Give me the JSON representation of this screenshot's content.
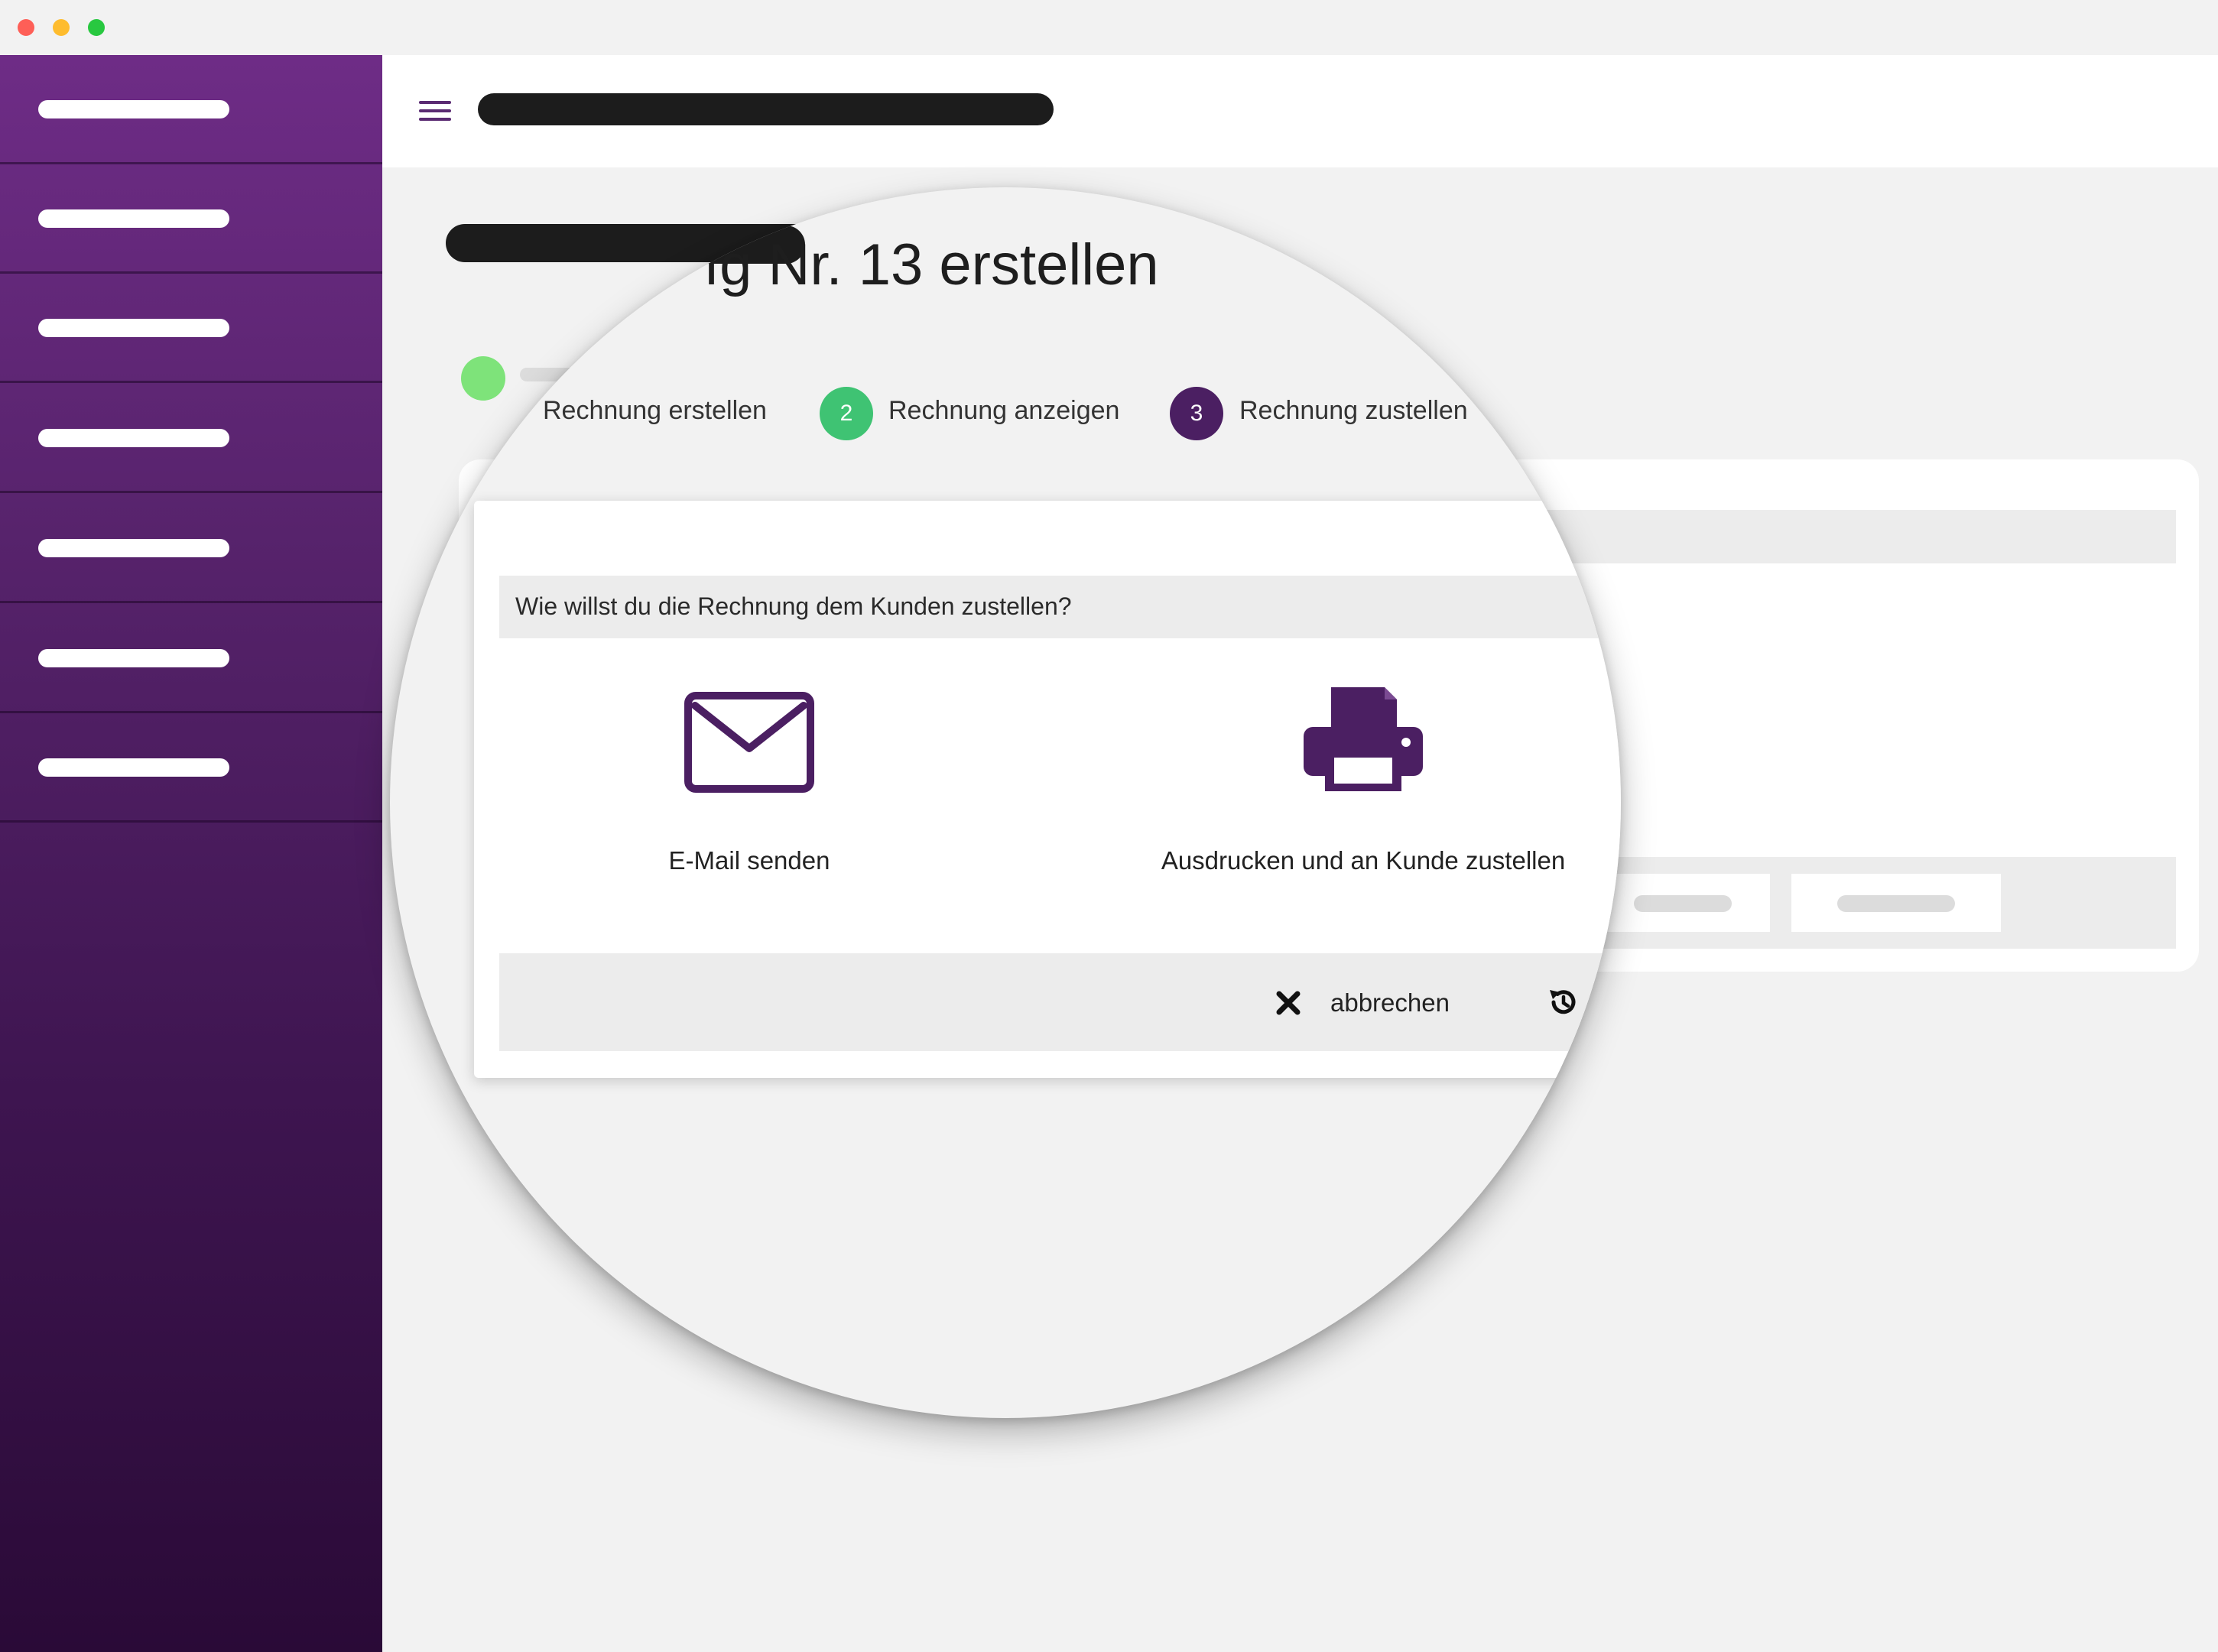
{
  "window": {
    "controls": [
      "close",
      "minimize",
      "maximize"
    ]
  },
  "sidebar": {
    "items": [
      {
        "id": "nav-1"
      },
      {
        "id": "nav-2"
      },
      {
        "id": "nav-3"
      },
      {
        "id": "nav-4"
      },
      {
        "id": "nav-5"
      },
      {
        "id": "nav-6"
      },
      {
        "id": "nav-7"
      }
    ]
  },
  "header": {
    "menu_icon": "hamburger-icon"
  },
  "page": {
    "title": "ıg Nr. 13 erstellen"
  },
  "steps": [
    {
      "number": "",
      "label": "Rechnung erstellen",
      "state": "done",
      "color": "#7ee37a"
    },
    {
      "number": "2",
      "label": "Rechnung anzeigen",
      "state": "done",
      "color": "#3fc373"
    },
    {
      "number": "3",
      "label": "Rechnung zustellen",
      "state": "active",
      "color": "#4b1f62"
    }
  ],
  "dialog": {
    "question": "Wie willst du die Rechnung dem Kunden zustellen?",
    "options": [
      {
        "label": "E-Mail senden",
        "icon": "envelope-icon"
      },
      {
        "label": "Ausdrucken und an Kunde zustellen",
        "icon": "printer-icon"
      }
    ],
    "cancel_label": "abbrechen",
    "cancel_icon": "close-icon",
    "reset_icon": "history-icon"
  },
  "colors": {
    "brand_purple": "#4b1f62",
    "sidebar_top": "#6e2c86",
    "sidebar_bottom": "#2a0a37",
    "success_green": "#3fc373",
    "light_green": "#7ee37a"
  }
}
